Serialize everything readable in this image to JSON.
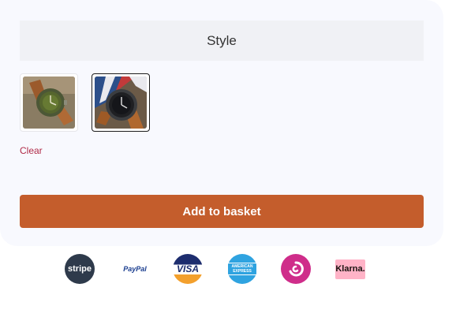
{
  "product_options": {
    "style_label": "Style",
    "swatches": [
      {
        "name": "green-dial-watch",
        "selected": false
      },
      {
        "name": "black-dial-watch",
        "selected": true
      }
    ],
    "clear_label": "Clear"
  },
  "actions": {
    "add_to_basket_label": "Add to basket"
  },
  "payment_methods": {
    "stripe": "stripe",
    "paypal": "PayPal",
    "visa": "VISA",
    "amex": "AMERICAN EXPRESS",
    "circle_icon": "spiral-icon",
    "klarna": "Klarna."
  },
  "colors": {
    "accent_button": "#c45d2c",
    "clear_link": "#b02a47",
    "panel_background": "#f8f9fe"
  }
}
